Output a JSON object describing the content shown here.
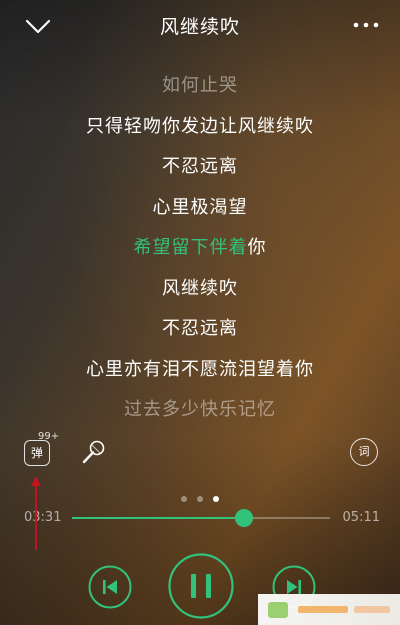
{
  "header": {
    "title": "风继续吹",
    "back_icon": "chevron-down-icon",
    "more_icon": "more-icon"
  },
  "lyrics": {
    "lines": [
      "如何止哭",
      "只得轻吻你发边让风继续吹",
      "不忍远离",
      "心里极渴望",
      "",
      "风继续吹",
      "不忍远离",
      "心里亦有泪不愿流泪望着你",
      "过去多少快乐记忆"
    ],
    "active_sung": "希望留下伴着",
    "active_rest": "你"
  },
  "tools": {
    "danmu_label": "弹",
    "danmu_count": "99+",
    "lyric_icon_label": "词"
  },
  "pager": {
    "pages": 3,
    "active": 3
  },
  "progress": {
    "current": "03:31",
    "total": "05:11",
    "fraction": 0.668
  },
  "colors": {
    "accent": "#31c27c",
    "annotation_arrow": "#c0141e"
  }
}
